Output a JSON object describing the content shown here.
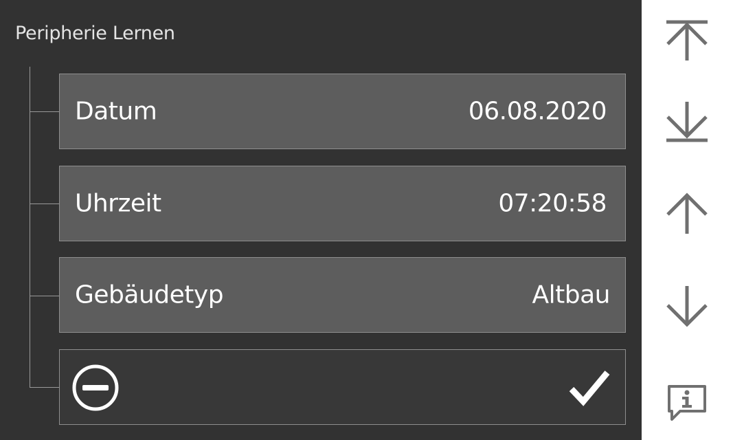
{
  "page": {
    "title": "Peripherie Lernen"
  },
  "rows": [
    {
      "label": "Datum",
      "value": "06.08.2020"
    },
    {
      "label": "Uhrzeit",
      "value": "07:20:58"
    },
    {
      "label": "Gebäudetyp",
      "value": "Altbau"
    }
  ],
  "actions": {
    "cancel_icon": "minus-circle-icon",
    "confirm_icon": "checkmark-icon"
  },
  "sidebar": {
    "buttons": [
      {
        "icon": "jump-to-top-icon"
      },
      {
        "icon": "jump-to-bottom-icon"
      },
      {
        "icon": "arrow-up-icon"
      },
      {
        "icon": "arrow-down-icon"
      },
      {
        "icon": "info-message-icon"
      }
    ]
  },
  "colors": {
    "background": "#323232",
    "row_fill": "#5d5d5d",
    "row_border": "#8f8f8f",
    "sidebar_bg": "#ffffff",
    "sidebar_icon": "#707070",
    "text": "#ffffff"
  }
}
